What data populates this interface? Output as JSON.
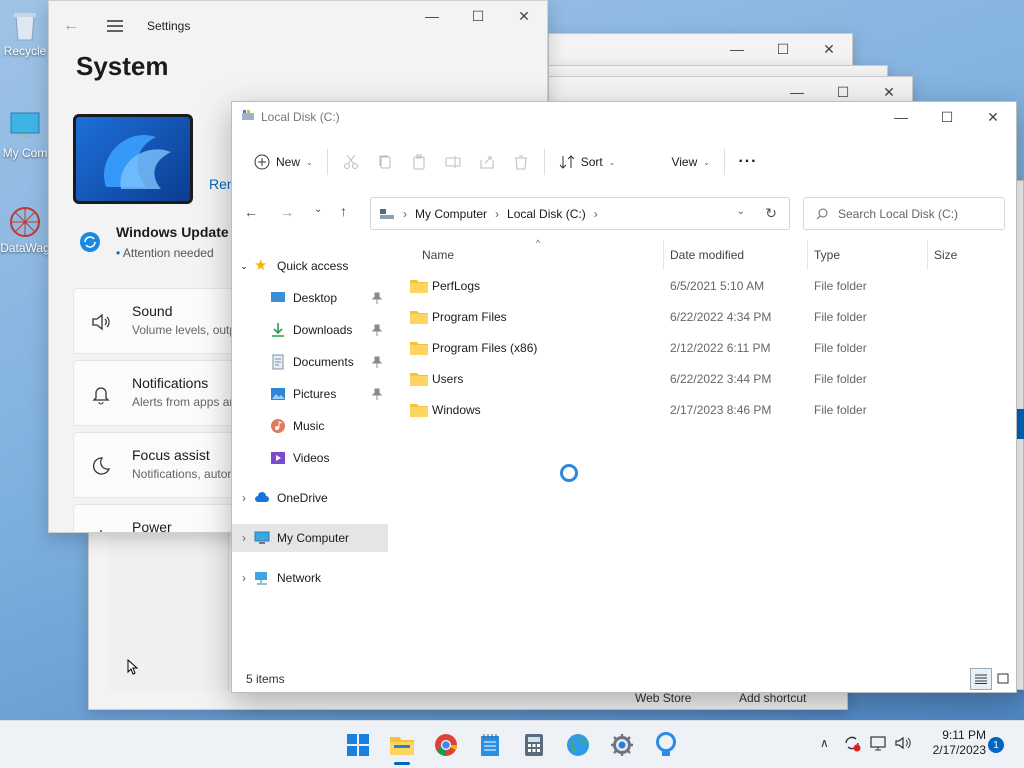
{
  "desktop": {
    "icons": [
      {
        "label": "Recycle"
      },
      {
        "label": "My Com"
      },
      {
        "label": "DataWag"
      }
    ],
    "background_text": [
      "Web Store",
      "Add shortcut"
    ]
  },
  "settings": {
    "window_title": "Settings",
    "page_title": "System",
    "rename_link": "Ren",
    "update": {
      "title": "Windows Update",
      "status": "Attention needed"
    },
    "rows": [
      {
        "title": "Sound",
        "desc": "Volume levels, outp"
      },
      {
        "title": "Notifications",
        "desc": "Alerts from apps an"
      },
      {
        "title": "Focus assist",
        "desc": "Notifications, autor"
      },
      {
        "title": "Power",
        "desc": ""
      }
    ]
  },
  "explorer": {
    "window_title": "Local Disk (C:)",
    "toolbar": {
      "new": "New",
      "sort": "Sort",
      "view": "View"
    },
    "address": {
      "crumbs": [
        "My Computer",
        "Local Disk (C:)"
      ]
    },
    "search_placeholder": "Search Local Disk (C:)",
    "nav": {
      "quick_access": "Quick access",
      "pinned": [
        "Desktop",
        "Downloads",
        "Documents",
        "Pictures"
      ],
      "unpinned": [
        "Music",
        "Videos"
      ],
      "onedrive": "OneDrive",
      "my_computer": "My Computer",
      "network": "Network"
    },
    "columns": {
      "name": "Name",
      "date": "Date modified",
      "type": "Type",
      "size": "Size"
    },
    "files": [
      {
        "name": "PerfLogs",
        "date": "6/5/2021 5:10 AM",
        "type": "File folder"
      },
      {
        "name": "Program Files",
        "date": "6/22/2022 4:34 PM",
        "type": "File folder"
      },
      {
        "name": "Program Files (x86)",
        "date": "2/12/2022 6:11 PM",
        "type": "File folder"
      },
      {
        "name": "Users",
        "date": "6/22/2022 3:44 PM",
        "type": "File folder"
      },
      {
        "name": "Windows",
        "date": "2/17/2023 8:46 PM",
        "type": "File folder"
      }
    ],
    "status": "5 items"
  },
  "taskbar": {
    "time": "9:11 PM",
    "date": "2/17/2023",
    "notification_count": "1"
  },
  "colors": {
    "accent": "#0067c0",
    "folder": "#f4c23c",
    "selection": "#e5e5e5"
  }
}
